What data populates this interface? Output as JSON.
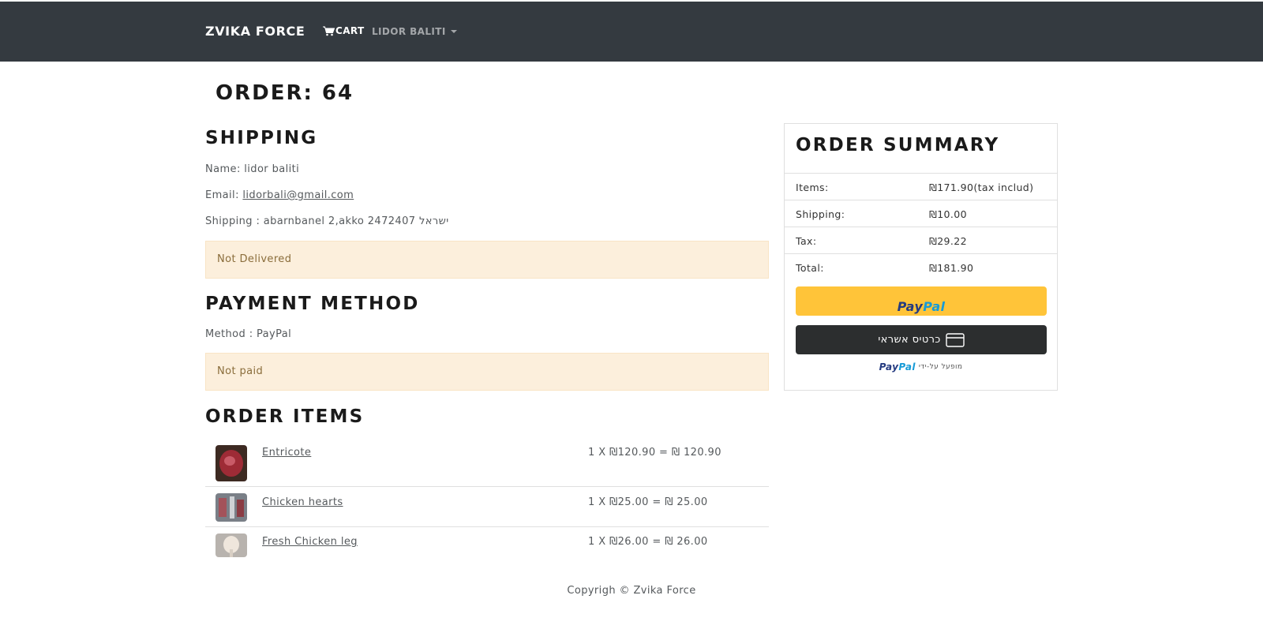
{
  "nav": {
    "brand": "ZVIKA FORCE",
    "cart_label": "CART",
    "user_label": "LIDOR BALITI"
  },
  "order": {
    "title": "ORDER: 64"
  },
  "shipping": {
    "heading": "SHIPPING",
    "name_line": "Name: lidor baliti",
    "email_label": "Email: ",
    "email": "lidorbali@gmail.com",
    "address_line": "Shipping : abarnbanel 2,akko 2472407 ישראל",
    "status": "Not Delivered"
  },
  "payment": {
    "heading": "PAYMENT METHOD",
    "method_line": "Method : PayPal",
    "status": "Not paid"
  },
  "order_items": {
    "heading": "ORDER ITEMS",
    "items": [
      {
        "name": "Entricote",
        "price": "1 X ₪120.90 = ₪ 120.90",
        "thumb_color": "#8b2a2e"
      },
      {
        "name": "Chicken hearts",
        "price": "1 X ₪25.00 = ₪ 25.00",
        "thumb_color": "#6b6e75"
      },
      {
        "name": "Fresh Chicken leg",
        "price": "1 X ₪26.00 = ₪ 26.00",
        "thumb_color": "#c9c4bf"
      }
    ]
  },
  "summary": {
    "heading": "ORDER SUMMARY",
    "rows": [
      {
        "label": "Items:",
        "value": "₪171.90(tax includ)"
      },
      {
        "label": "Shipping:",
        "value": "₪10.00"
      },
      {
        "label": "Tax:",
        "value": "₪29.22"
      },
      {
        "label": "Total:",
        "value": "₪181.90"
      }
    ],
    "paypal_pay": "Pay",
    "paypal_pal": "Pal",
    "card_button": "כרטיס אשראי",
    "powered_text": "מופעל על-ידי",
    "colors": {
      "paypal_yellow": "#ffc439",
      "card_dark": "#2c2e2f",
      "alert_bg": "#fcefdc",
      "navbar": "#343a40"
    }
  },
  "footer": {
    "text": "Copyrigh © Zvika Force"
  }
}
